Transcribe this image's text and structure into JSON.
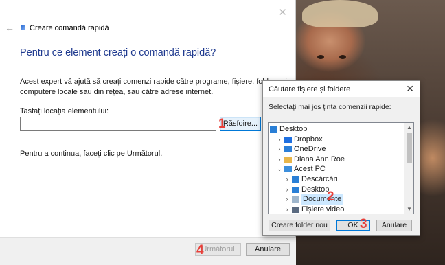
{
  "wizard": {
    "title": "Creare comandă rapidă",
    "heading": "Pentru ce element creați o comandă rapidă?",
    "description": "Acest expert vă ajută să creați comenzi rapide către programe, fișiere, foldere și computere locale sau din rețea, sau către adrese internet.",
    "location_label": "Tastați locația elementului:",
    "location_value": "",
    "browse_label": "Răsfoire...",
    "hint": "Pentru a continua, faceți clic pe Următorul.",
    "next_label": "Următorul",
    "cancel_label": "Anulare",
    "close_icon": "close-icon",
    "back_icon": "back-arrow-icon"
  },
  "dialog": {
    "title": "Căutare fișiere și foldere",
    "instruction": "Selectați mai jos ținta comenzii rapide:",
    "tree": [
      {
        "label": "Desktop",
        "icon": "desktop-icon",
        "expander": "",
        "selected": false
      },
      {
        "label": "Dropbox",
        "icon": "dropbox-icon",
        "expander": ">",
        "selected": false
      },
      {
        "label": "OneDrive",
        "icon": "onedrive-icon",
        "expander": ">",
        "selected": false
      },
      {
        "label": "Diana Ann Roe",
        "icon": "user-folder-icon",
        "expander": ">",
        "selected": false
      },
      {
        "label": "Acest PC",
        "icon": "computer-icon",
        "expander": "v",
        "selected": false
      },
      {
        "label": "Descărcări",
        "icon": "downloads-icon",
        "expander": ">",
        "selected": false
      },
      {
        "label": "Desktop",
        "icon": "desktop-icon",
        "expander": ">",
        "selected": false
      },
      {
        "label": "Documente",
        "icon": "documents-icon",
        "expander": ">",
        "selected": true
      },
      {
        "label": "Fișiere video",
        "icon": "videos-icon",
        "expander": ">",
        "selected": false
      }
    ],
    "new_folder_label": "Creare folder nou",
    "ok_label": "OK",
    "cancel_label": "Anulare"
  },
  "steps": {
    "one": "1",
    "two": "2",
    "three": "3",
    "four": "4"
  },
  "colors": {
    "heading": "#1f3a8f",
    "accent": "#0078d7",
    "step_marker": "#e8403a",
    "selection": "#cce8ff"
  }
}
